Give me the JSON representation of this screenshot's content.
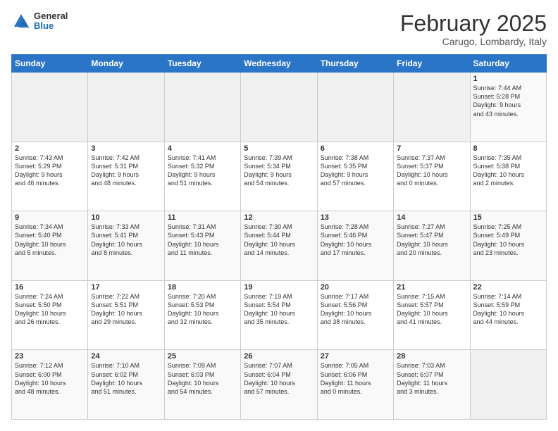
{
  "header": {
    "logo_general": "General",
    "logo_blue": "Blue",
    "month": "February 2025",
    "location": "Carugo, Lombardy, Italy"
  },
  "days_of_week": [
    "Sunday",
    "Monday",
    "Tuesday",
    "Wednesday",
    "Thursday",
    "Friday",
    "Saturday"
  ],
  "weeks": [
    [
      {
        "day": "",
        "info": ""
      },
      {
        "day": "",
        "info": ""
      },
      {
        "day": "",
        "info": ""
      },
      {
        "day": "",
        "info": ""
      },
      {
        "day": "",
        "info": ""
      },
      {
        "day": "",
        "info": ""
      },
      {
        "day": "1",
        "info": "Sunrise: 7:44 AM\nSunset: 5:28 PM\nDaylight: 9 hours\nand 43 minutes."
      }
    ],
    [
      {
        "day": "2",
        "info": "Sunrise: 7:43 AM\nSunset: 5:29 PM\nDaylight: 9 hours\nand 46 minutes."
      },
      {
        "day": "3",
        "info": "Sunrise: 7:42 AM\nSunset: 5:31 PM\nDaylight: 9 hours\nand 48 minutes."
      },
      {
        "day": "4",
        "info": "Sunrise: 7:41 AM\nSunset: 5:32 PM\nDaylight: 9 hours\nand 51 minutes."
      },
      {
        "day": "5",
        "info": "Sunrise: 7:39 AM\nSunset: 5:34 PM\nDaylight: 9 hours\nand 54 minutes."
      },
      {
        "day": "6",
        "info": "Sunrise: 7:38 AM\nSunset: 5:35 PM\nDaylight: 9 hours\nand 57 minutes."
      },
      {
        "day": "7",
        "info": "Sunrise: 7:37 AM\nSunset: 5:37 PM\nDaylight: 10 hours\nand 0 minutes."
      },
      {
        "day": "8",
        "info": "Sunrise: 7:35 AM\nSunset: 5:38 PM\nDaylight: 10 hours\nand 2 minutes."
      }
    ],
    [
      {
        "day": "9",
        "info": "Sunrise: 7:34 AM\nSunset: 5:40 PM\nDaylight: 10 hours\nand 5 minutes."
      },
      {
        "day": "10",
        "info": "Sunrise: 7:33 AM\nSunset: 5:41 PM\nDaylight: 10 hours\nand 8 minutes."
      },
      {
        "day": "11",
        "info": "Sunrise: 7:31 AM\nSunset: 5:43 PM\nDaylight: 10 hours\nand 11 minutes."
      },
      {
        "day": "12",
        "info": "Sunrise: 7:30 AM\nSunset: 5:44 PM\nDaylight: 10 hours\nand 14 minutes."
      },
      {
        "day": "13",
        "info": "Sunrise: 7:28 AM\nSunset: 5:46 PM\nDaylight: 10 hours\nand 17 minutes."
      },
      {
        "day": "14",
        "info": "Sunrise: 7:27 AM\nSunset: 5:47 PM\nDaylight: 10 hours\nand 20 minutes."
      },
      {
        "day": "15",
        "info": "Sunrise: 7:25 AM\nSunset: 5:49 PM\nDaylight: 10 hours\nand 23 minutes."
      }
    ],
    [
      {
        "day": "16",
        "info": "Sunrise: 7:24 AM\nSunset: 5:50 PM\nDaylight: 10 hours\nand 26 minutes."
      },
      {
        "day": "17",
        "info": "Sunrise: 7:22 AM\nSunset: 5:51 PM\nDaylight: 10 hours\nand 29 minutes."
      },
      {
        "day": "18",
        "info": "Sunrise: 7:20 AM\nSunset: 5:53 PM\nDaylight: 10 hours\nand 32 minutes."
      },
      {
        "day": "19",
        "info": "Sunrise: 7:19 AM\nSunset: 5:54 PM\nDaylight: 10 hours\nand 35 minutes."
      },
      {
        "day": "20",
        "info": "Sunrise: 7:17 AM\nSunset: 5:56 PM\nDaylight: 10 hours\nand 38 minutes."
      },
      {
        "day": "21",
        "info": "Sunrise: 7:15 AM\nSunset: 5:57 PM\nDaylight: 10 hours\nand 41 minutes."
      },
      {
        "day": "22",
        "info": "Sunrise: 7:14 AM\nSunset: 5:59 PM\nDaylight: 10 hours\nand 44 minutes."
      }
    ],
    [
      {
        "day": "23",
        "info": "Sunrise: 7:12 AM\nSunset: 6:00 PM\nDaylight: 10 hours\nand 48 minutes."
      },
      {
        "day": "24",
        "info": "Sunrise: 7:10 AM\nSunset: 6:02 PM\nDaylight: 10 hours\nand 51 minutes."
      },
      {
        "day": "25",
        "info": "Sunrise: 7:09 AM\nSunset: 6:03 PM\nDaylight: 10 hours\nand 54 minutes."
      },
      {
        "day": "26",
        "info": "Sunrise: 7:07 AM\nSunset: 6:04 PM\nDaylight: 10 hours\nand 57 minutes."
      },
      {
        "day": "27",
        "info": "Sunrise: 7:05 AM\nSunset: 6:06 PM\nDaylight: 11 hours\nand 0 minutes."
      },
      {
        "day": "28",
        "info": "Sunrise: 7:03 AM\nSunset: 6:07 PM\nDaylight: 11 hours\nand 3 minutes."
      },
      {
        "day": "",
        "info": ""
      }
    ]
  ]
}
